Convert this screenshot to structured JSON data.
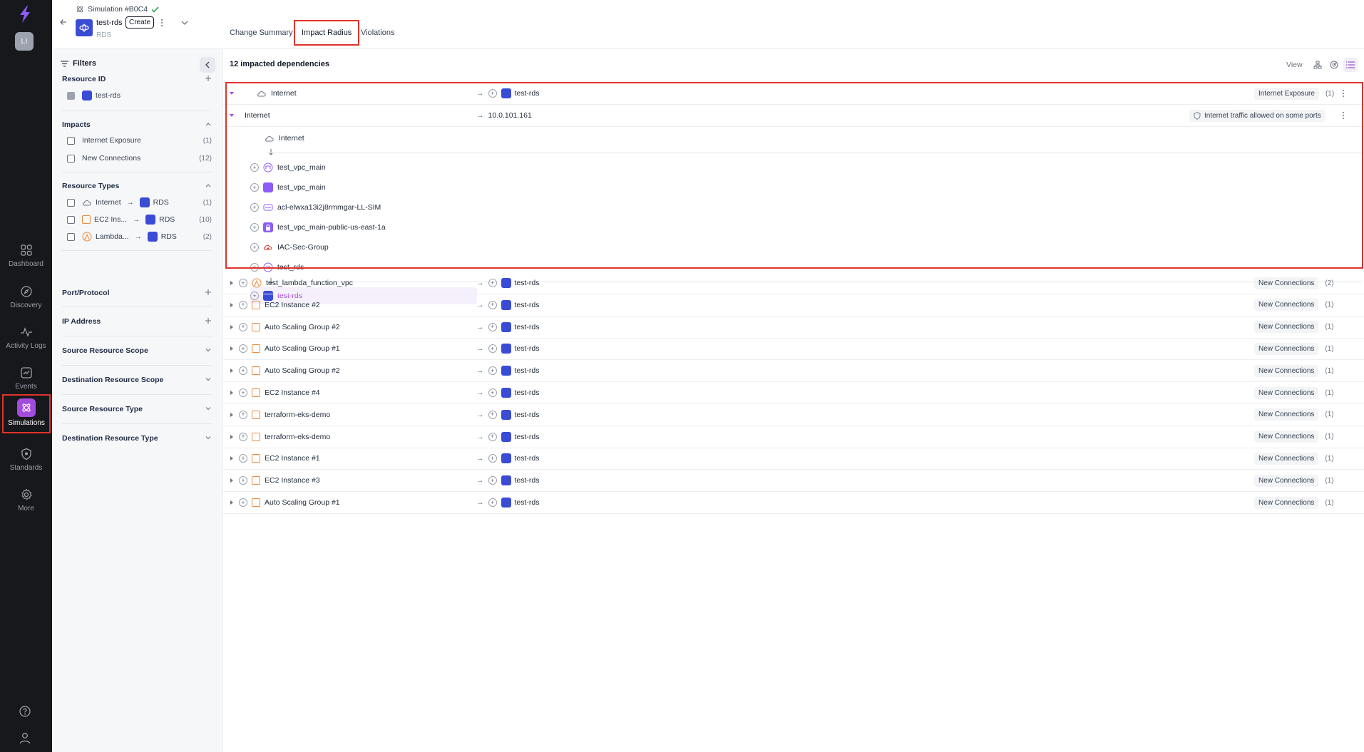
{
  "rail": {
    "avatar": "LI",
    "nav": [
      {
        "label": "Dashboard"
      },
      {
        "label": "Discovery"
      },
      {
        "label": "Activity Logs"
      },
      {
        "label": "Events"
      },
      {
        "label": "Simulations"
      },
      {
        "label": "Standards"
      },
      {
        "label": "More"
      }
    ]
  },
  "header": {
    "simulation": "Simulation #B0C4",
    "resource_name": "test-rds",
    "badge": "Create",
    "resource_type": "RDS",
    "tabs": [
      {
        "label": "Change Summary"
      },
      {
        "label": "Impact Radius"
      },
      {
        "label": "Violations"
      }
    ]
  },
  "filters": {
    "title": "Filters",
    "resource_id": {
      "label": "Resource ID",
      "option": "test-rds"
    },
    "impacts": {
      "label": "Impacts",
      "options": [
        {
          "label": "Internet Exposure",
          "count": "(1)"
        },
        {
          "label": "New Connections",
          "count": "(12)"
        }
      ]
    },
    "resource_types": {
      "label": "Resource Types",
      "options": [
        {
          "from": "Internet",
          "to": "RDS",
          "count": "(1)"
        },
        {
          "from": "EC2 Ins...",
          "to": "RDS",
          "count": "(10)"
        },
        {
          "from": "Lambda...",
          "to": "RDS",
          "count": "(2)"
        }
      ]
    },
    "port_protocol": "Port/Protocol",
    "ip_address": "IP Address",
    "source_scope": "Source Resource Scope",
    "dest_scope": "Destination Resource Scope",
    "source_type": "Source Resource Type",
    "dest_type": "Destination Resource Type"
  },
  "main": {
    "title": "12 impacted dependencies",
    "view_label": "View",
    "expanded": {
      "source": "Internet",
      "target": "test-rds",
      "impact": "Internet Exposure",
      "impact_count": "(1)",
      "sub_source": "Internet",
      "sub_target": "10.0.101.161",
      "sub_badge": "Internet traffic allowed on some ports",
      "path": [
        {
          "label": "Internet"
        },
        {
          "label": "test_vpc_main"
        },
        {
          "label": "test_vpc_main"
        },
        {
          "label": "acl-elwxa13i2j8rmmgar-LL-SIM"
        },
        {
          "label": "test_vpc_main-public-us-east-1a"
        },
        {
          "label": "IAC-Sec-Group"
        },
        {
          "label": "test_rds"
        },
        {
          "label": "test-rds"
        }
      ]
    },
    "rows": [
      {
        "source": "test_lambda_function_vpc",
        "target": "test-rds",
        "impact": "New Connections",
        "count": "(2)"
      },
      {
        "source": "EC2 Instance #2",
        "target": "test-rds",
        "impact": "New Connections",
        "count": "(1)"
      },
      {
        "source": "Auto Scaling Group #2",
        "target": "test-rds",
        "impact": "New Connections",
        "count": "(1)"
      },
      {
        "source": "Auto Scaling Group #1",
        "target": "test-rds",
        "impact": "New Connections",
        "count": "(1)"
      },
      {
        "source": "Auto Scaling Group #2",
        "target": "test-rds",
        "impact": "New Connections",
        "count": "(1)"
      },
      {
        "source": "EC2 Instance #4",
        "target": "test-rds",
        "impact": "New Connections",
        "count": "(1)"
      },
      {
        "source": "terraform-eks-demo",
        "target": "test-rds",
        "impact": "New Connections",
        "count": "(1)"
      },
      {
        "source": "terraform-eks-demo",
        "target": "test-rds",
        "impact": "New Connections",
        "count": "(1)"
      },
      {
        "source": "EC2 Instance #1",
        "target": "test-rds",
        "impact": "New Connections",
        "count": "(1)"
      },
      {
        "source": "EC2 Instance #3",
        "target": "test-rds",
        "impact": "New Connections",
        "count": "(1)"
      },
      {
        "source": "Auto Scaling Group #1",
        "target": "test-rds",
        "impact": "New Connections",
        "count": "(1)"
      }
    ]
  },
  "colors": {
    "accent": "#a34bdc",
    "highlight": "#e0332b",
    "rds": "#3a4bd4",
    "ec2": "#ef8b3c"
  }
}
